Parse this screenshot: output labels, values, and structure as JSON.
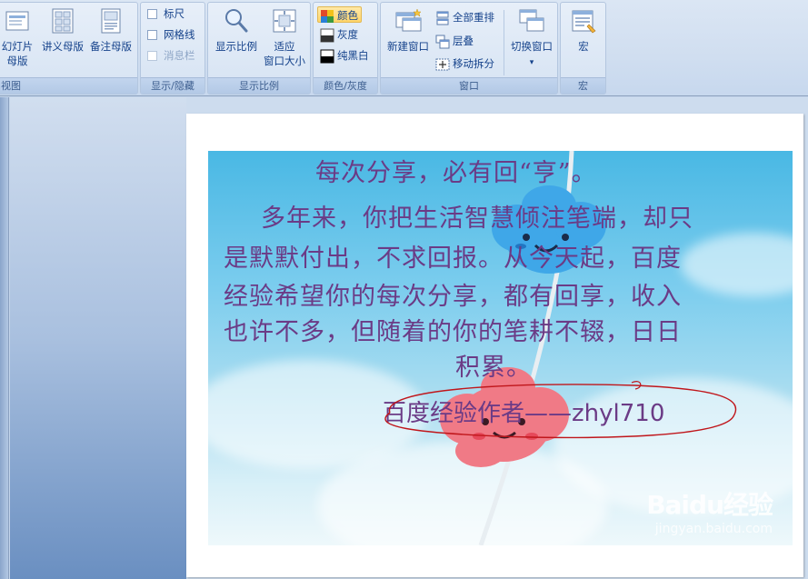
{
  "ribbon": {
    "master_views_group": {
      "label": "视图",
      "slide_master_line1": "幻灯片",
      "slide_master_line2": "母版",
      "handout_master": "讲义母版",
      "notes_master": "备注母版"
    },
    "show_hide_group": {
      "label": "显示/隐藏",
      "ruler": "标尺",
      "gridlines": "网格线",
      "message_bar": "消息栏"
    },
    "zoom_group": {
      "label": "显示比例",
      "zoom": "显示比例",
      "fit_line1": "适应",
      "fit_line2": "窗口大小"
    },
    "color_group": {
      "label": "颜色/灰度",
      "color": "颜色",
      "grayscale": "灰度",
      "pure_bw": "纯黑白"
    },
    "window_group": {
      "label": "窗口",
      "new_window": "新建窗口",
      "arrange_all": "全部重排",
      "cascade": "层叠",
      "move_split": "移动拆分",
      "switch_window": "切换窗口"
    },
    "macro_group": {
      "label": "宏",
      "macros": "宏"
    }
  },
  "slide": {
    "line1": "每次分享，必有回“亨”。",
    "line2": "多年来，你把生活智慧倾注笔端，却只",
    "line3": "是默默付出，不求回报。从今天起，百度",
    "line4": "经验希望你的每次分享，都有回享，收入",
    "line5": "也许不多，但随着的你的笔耕不辍，日日",
    "line6": "积累。",
    "signature": "百度经验作者——zhyl710",
    "watermark_brand": "Baidu经验",
    "watermark_url": "jingyan.baidu.com"
  },
  "colors": {
    "slide_text": "#6b3b86",
    "annotation_ink": "#c0161b",
    "ribbon_text": "#15428b"
  }
}
